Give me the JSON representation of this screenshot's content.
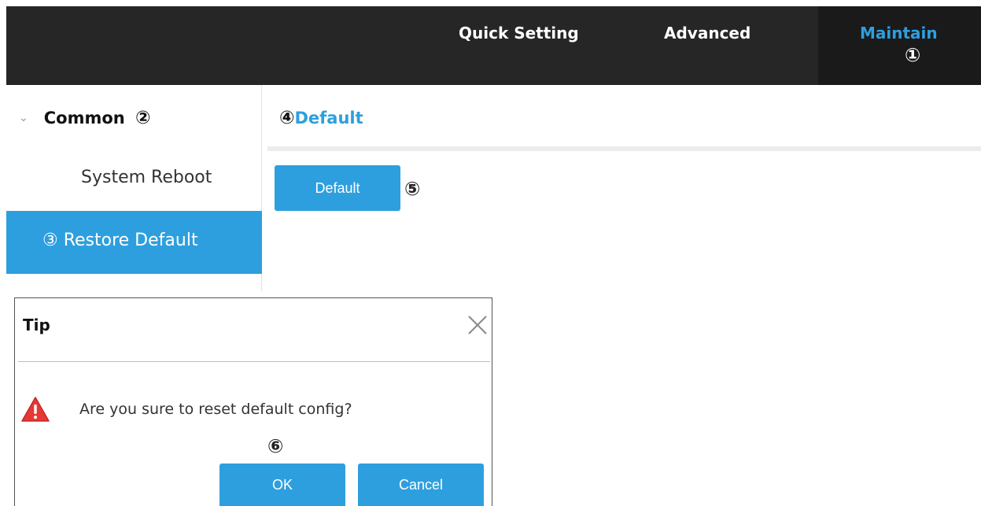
{
  "colors": {
    "accent": "#2e9fde",
    "topbar": "#262626",
    "warning": "#e53935"
  },
  "nav": {
    "items": [
      {
        "label": "Quick Setting"
      },
      {
        "label": "Advanced"
      },
      {
        "label": "Maintain",
        "active": true
      }
    ],
    "marker": "①"
  },
  "sidebar": {
    "group": {
      "label": "Common",
      "marker": "②",
      "icon": "chevron-down-icon"
    },
    "items": [
      {
        "label": "System Reboot"
      },
      {
        "label": "③ Restore Default",
        "active": true
      }
    ]
  },
  "main": {
    "title_marker": "④",
    "title": "Default",
    "default_button_label": "Default",
    "button_marker": "⑤"
  },
  "dialog": {
    "title": "Tip",
    "close_icon": "close-icon",
    "warning_icon": "warning-icon",
    "message": "Are you sure to reset default config?",
    "marker": "⑥",
    "ok_label": "OK",
    "cancel_label": "Cancel"
  }
}
